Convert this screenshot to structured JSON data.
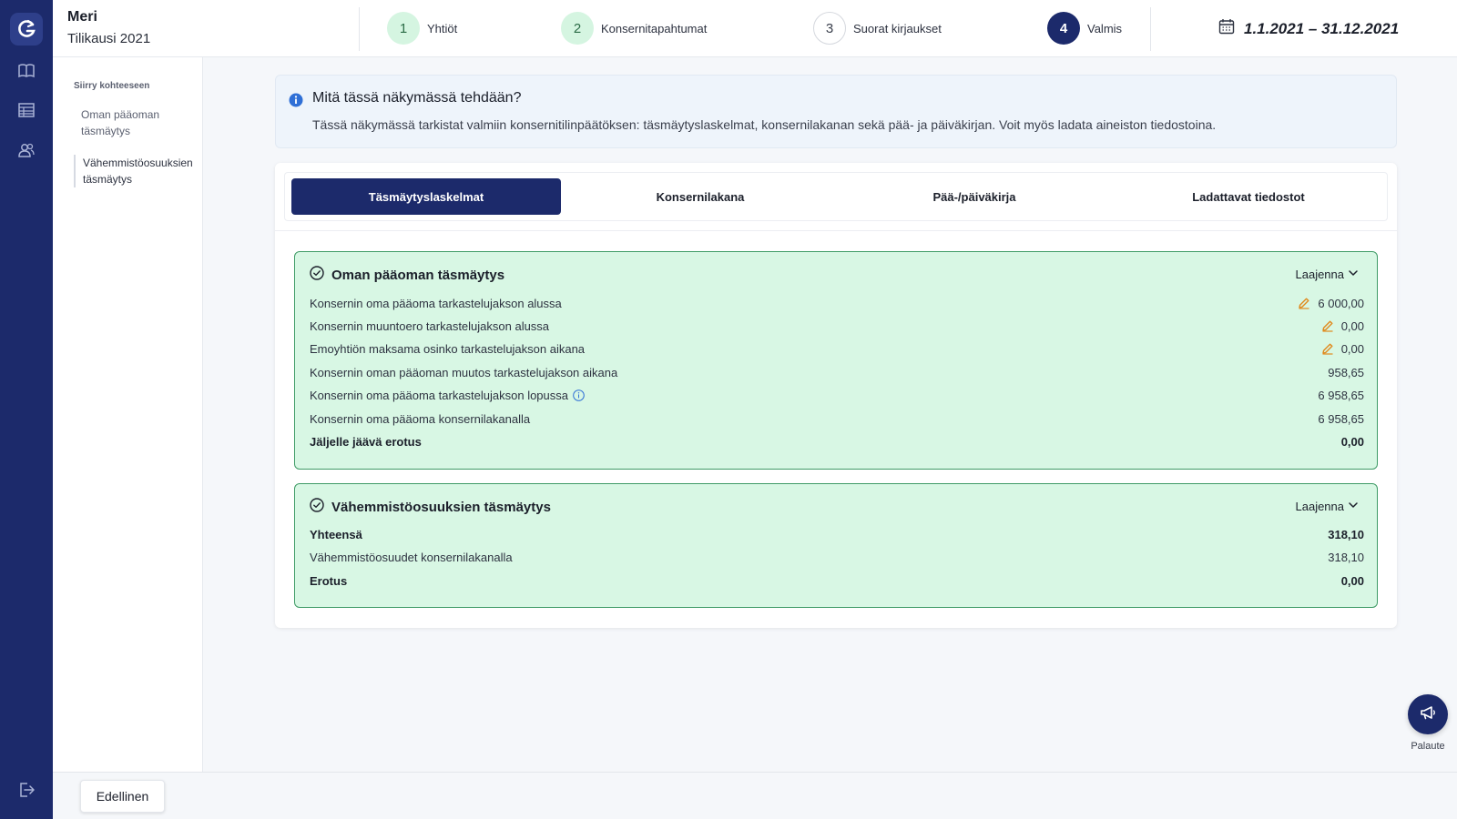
{
  "header": {
    "company_name": "Meri",
    "fiscal_period": "Tilikausi 2021",
    "steps": [
      {
        "number": "1",
        "label": "Yhtiöt",
        "state": "done"
      },
      {
        "number": "2",
        "label": "Konsernitapahtumat",
        "state": "done"
      },
      {
        "number": "3",
        "label": "Suorat kirjaukset",
        "state": "todo"
      },
      {
        "number": "4",
        "label": "Valmis",
        "state": "active"
      }
    ],
    "date_range": "1.1.2021 – 31.12.2021"
  },
  "rail": {
    "icons": [
      "app-logo-icon",
      "book-icon",
      "table-icon",
      "users-icon",
      "logout-icon"
    ]
  },
  "sidenav": {
    "heading": "Siirry kohteeseen",
    "items": [
      {
        "label": "Oman pääoman täsmäytys"
      },
      {
        "label": "Vähemmistöosuuksien täsmäytys"
      }
    ]
  },
  "info": {
    "title": "Mitä tässä näkymässä tehdään?",
    "text": "Tässä näkymässä tarkistat valmiin konsernitilinpäätöksen: täsmäytyslaskelmat, konsernilakanan sekä pää- ja päiväkirjan. Voit myös ladata aineiston tiedostoina."
  },
  "tabs": [
    {
      "label": "Täsmäytyslaskelmat",
      "active": true
    },
    {
      "label": "Konsernilakana",
      "active": false
    },
    {
      "label": "Pää-/päiväkirja",
      "active": false
    },
    {
      "label": "Ladattavat tiedostot",
      "active": false
    }
  ],
  "equity_card": {
    "title": "Oman pääoman täsmäytys",
    "expand_label": "Laajenna",
    "rows": [
      {
        "label": "Konsernin oma pääoma tarkastelujakson alussa",
        "value": "6 000,00",
        "editable": true
      },
      {
        "label": "Konsernin muuntoero tarkastelujakson alussa",
        "value": "0,00",
        "editable": true
      },
      {
        "label": "Emoyhtiön maksama osinko tarkastelujakson aikana",
        "value": "0,00",
        "editable": true
      },
      {
        "label": "Konsernin oman pääoman muutos tarkastelujakson aikana",
        "value": "958,65",
        "editable": false
      },
      {
        "label": "Konsernin oma pääoma tarkastelujakson lopussa",
        "value": "6 958,65",
        "editable": false,
        "info": true
      },
      {
        "label": "Konsernin oma pääoma konsernilakanalla",
        "value": "6 958,65",
        "editable": false
      },
      {
        "label": "Jäljelle jäävä erotus",
        "value": "0,00",
        "editable": false,
        "bold": true
      }
    ]
  },
  "minority_card": {
    "title": "Vähemmistöosuuksien täsmäytys",
    "expand_label": "Laajenna",
    "rows": [
      {
        "label": "Yhteensä",
        "value": "318,10",
        "bold": true
      },
      {
        "label": "Vähemmistöosuudet konsernilakanalla",
        "value": "318,10",
        "bold": false
      },
      {
        "label": "Erotus",
        "value": "0,00",
        "bold": true
      }
    ]
  },
  "footer": {
    "prev_label": "Edellinen",
    "feedback_label": "Palaute"
  },
  "colors": {
    "brand_navy": "#1c2a6b",
    "success_green_bg": "#d8f7e4",
    "success_green_border": "#3f9b66",
    "edit_orange": "#e08a1e",
    "info_blue": "#2f6fd6"
  }
}
